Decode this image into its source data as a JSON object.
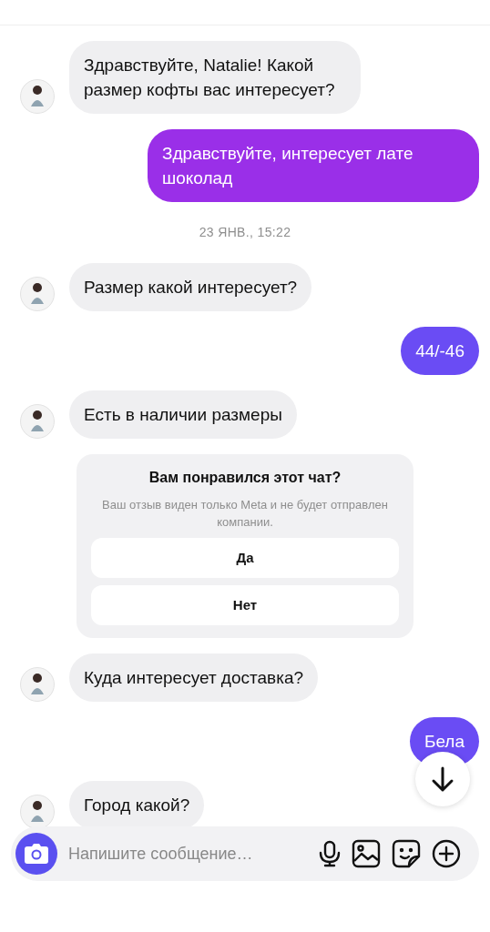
{
  "messages": [
    {
      "kind": "incoming",
      "text": "Здравствуйте, Natalie! Какой размер кофты вас интересует?"
    },
    {
      "kind": "outgoing",
      "text": "Здравствуйте, интересует лате шоколад"
    },
    {
      "kind": "timestamp",
      "text": "23 ЯНВ., 15:22"
    },
    {
      "kind": "incoming",
      "text": "Размер какой интересует?"
    },
    {
      "kind": "outgoing",
      "text": "44/-46"
    },
    {
      "kind": "incoming",
      "text": "Есть в наличии размеры"
    },
    {
      "kind": "survey",
      "title": "Вам понравился этот чат?",
      "subtitle": "Ваш отзыв виден только Meta и не будет отправлен компании.",
      "options": [
        "Да",
        "Нет"
      ]
    },
    {
      "kind": "incoming",
      "text": "Куда интересует доставка?"
    },
    {
      "kind": "outgoing",
      "text": "Бела"
    },
    {
      "kind": "incoming",
      "text": "Город какой?"
    }
  ],
  "composer": {
    "placeholder": "Напишите сообщение…"
  }
}
